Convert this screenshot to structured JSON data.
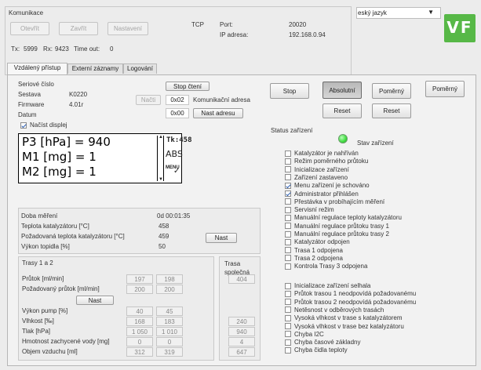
{
  "connection": {
    "title": "Komunikace",
    "open_label": "Otevřít",
    "close_label": "Zavřít",
    "settings_label": "Nastavení",
    "tcp_label": "TCP",
    "port_label": "Port:",
    "port_value": "20020",
    "ip_label": "IP adresa:",
    "ip_value": "192.168.0.94",
    "tx_label": "Tx:",
    "tx_value": "5999",
    "rx_label": "Rx:",
    "rx_value": "9423",
    "timeout_label": "Time out:",
    "timeout_value": "0"
  },
  "language": {
    "selected": "eský jazyk"
  },
  "logo": {
    "text": "VF"
  },
  "tabs": [
    {
      "label": "Vzdálený přístup"
    },
    {
      "label": "Externí záznamy"
    },
    {
      "label": "Logování"
    }
  ],
  "device": {
    "serial_label": "Seriové číslo",
    "assembly_label": "Sestava",
    "assembly_value": "K0220",
    "firmware_label": "Firmware",
    "firmware_value": "4.01r",
    "date_label": "Datum",
    "load_button": "Načti",
    "stop_reading_button": "Stop čtení",
    "comm_address_value": "0x02",
    "comm_address_label": "Komunikační adresa",
    "new_address_value": "0x00",
    "set_address_button": "Nast adresu"
  },
  "display": {
    "checkbox_label": "Načíst displej",
    "checked": true,
    "lines": [
      "P3 [hPa] = 940",
      "M1 [mg] = 1",
      "M2 [mg] = 1"
    ],
    "side_top": "Tk:458",
    "side_mid": "ABS",
    "side_bottom": "MENU"
  },
  "controls": {
    "stop_label": "Stop",
    "absolute_label": "Absolutní",
    "proportional_label_1": "Poměrný",
    "proportional_label_2": "Poměrný",
    "reset_label_1": "Reset",
    "reset_label_2": "Reset"
  },
  "measurement": {
    "time_label": "Doba měření",
    "time_value": "0d 00:01:35",
    "cat_temp_label": "Teplota katalyzátoru [°C]",
    "cat_temp_value": "458",
    "req_temp_label": "Požadovaná teplota katalyzátoru [°C]",
    "req_temp_value": "459",
    "set_button": "Nast",
    "heater_label": "Výkon topidla [%]",
    "heater_value": "50"
  },
  "routes": {
    "title": "Trasy 1 a 2",
    "common_title": "Trasa společná",
    "set_button": "Nast",
    "rows": [
      {
        "label": "Průtok [ml/min]",
        "t1": "197",
        "t2": "198",
        "common": "404"
      },
      {
        "label": "Požadovaný průtok [ml/min]",
        "t1": "200",
        "t2": "200",
        "common": ""
      },
      {
        "label": "Výkon pump [%]",
        "t1": "40",
        "t2": "45",
        "common": ""
      },
      {
        "label": "Vlhkost [‰]",
        "t1": "168",
        "t2": "183",
        "common": "240"
      },
      {
        "label": "Tlak [hPa]",
        "t1": "1 050",
        "t2": "1 010",
        "common": "940"
      },
      {
        "label": "Hmotnost zachycené vody [mg]",
        "t1": "0",
        "t2": "0",
        "common": "4"
      },
      {
        "label": "Objem vzduchu [ml]",
        "t1": "312",
        "t2": "319",
        "common": "647"
      }
    ]
  },
  "status": {
    "title": "Status zařízení",
    "state_label": "Stav zařízení",
    "led_color": "#3fdc3f",
    "items": [
      {
        "label": "Katalyzátor je nahříván",
        "checked": false
      },
      {
        "label": "Režim poměrného průtoku",
        "checked": false
      },
      {
        "label": "Inicializace zařízení",
        "checked": false
      },
      {
        "label": "Zařízení zastaveno",
        "checked": false
      },
      {
        "label": "Menu zařízení je schováno",
        "checked": true
      },
      {
        "label": "Administrator přihlášen",
        "checked": true
      },
      {
        "label": "Přestávka v probíhajícím měření",
        "checked": false
      },
      {
        "label": "Servisní režim",
        "checked": false
      },
      {
        "label": "Manuální regulace teploty katalyzátoru",
        "checked": false
      },
      {
        "label": "Manuální regulace průtoku trasy 1",
        "checked": false
      },
      {
        "label": "Manuální regulace průtoku trasy 2",
        "checked": false
      },
      {
        "label": "Katalyzátor odpojen",
        "checked": false
      },
      {
        "label": "Trasa 1 odpojena",
        "checked": false
      },
      {
        "label": "Trasa 2 odpojena",
        "checked": false
      },
      {
        "label": "Kontrola Trasy 3 odpojena",
        "checked": false
      }
    ],
    "errors": [
      {
        "label": "Inicializace zařízení selhala",
        "checked": false
      },
      {
        "label": "Průtok trasou 1 neodpovídá požadovanému",
        "checked": false
      },
      {
        "label": "Průtok trasou 2 neodpovídá požadovanému",
        "checked": false
      },
      {
        "label": "Netěsnost v odběrových trasách",
        "checked": false
      },
      {
        "label": "Vysoká vlhkost v trase s katalyzátorem",
        "checked": false
      },
      {
        "label": "Vysoká vlhkost v trase bez katalyzátoru",
        "checked": false
      },
      {
        "label": "Chyba I2C",
        "checked": false
      },
      {
        "label": "Chyba časové základny",
        "checked": false
      },
      {
        "label": "Chyba čidla teploty",
        "checked": false
      }
    ]
  }
}
